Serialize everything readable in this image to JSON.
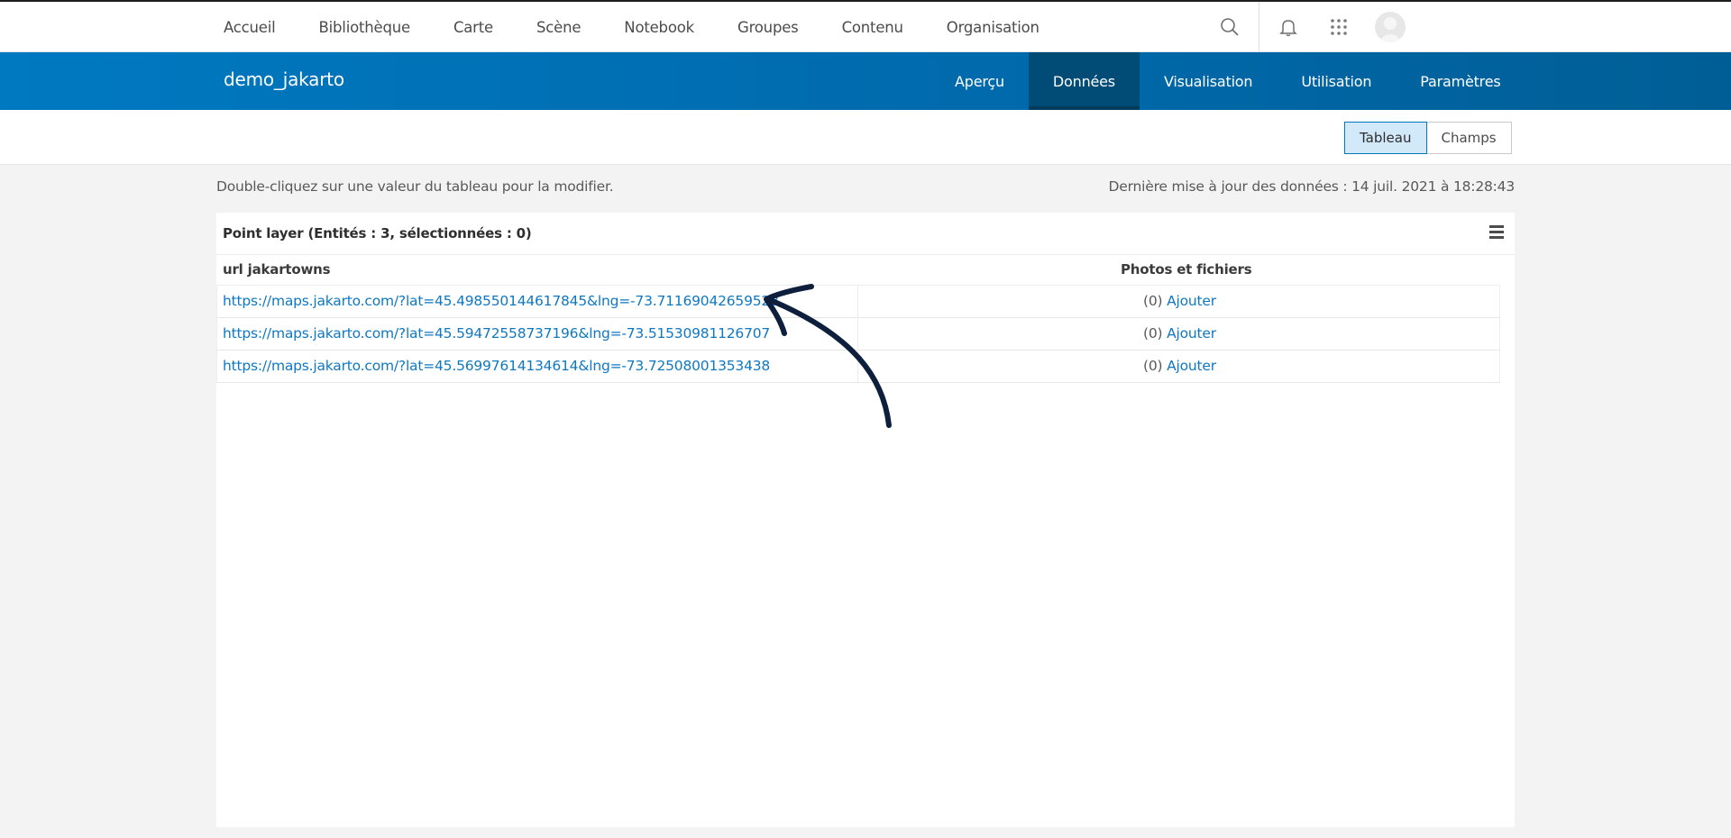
{
  "topnav": {
    "items": [
      "Accueil",
      "Bibliothèque",
      "Carte",
      "Scène",
      "Notebook",
      "Groupes",
      "Contenu",
      "Organisation"
    ]
  },
  "header": {
    "title": "demo_jakarto",
    "tabs": [
      "Aperçu",
      "Données",
      "Visualisation",
      "Utilisation",
      "Paramètres"
    ],
    "active_tab": "Données"
  },
  "view_toggle": {
    "table_label": "Tableau",
    "fields_label": "Champs",
    "active": "Tableau"
  },
  "hint_text": "Double-cliquez sur une valeur du tableau pour la modifier.",
  "last_updated": "Dernière mise à jour des données : 14 juil. 2021 à 18:28:43",
  "layer_table": {
    "title": "Point layer (Entités : 3, sélectionnées : 0)",
    "columns": [
      "url jakartowns",
      "Photos et fichiers"
    ],
    "rows": [
      {
        "url": "https://maps.jakarto.com/?lat=45.498550144617845&lng=-73.71169042659523",
        "count": "(0)",
        "action": "Ajouter"
      },
      {
        "url": "https://maps.jakarto.com/?lat=45.59472558737196&lng=-73.51530981126707",
        "count": "(0)",
        "action": "Ajouter"
      },
      {
        "url": "https://maps.jakarto.com/?lat=45.56997614134614&lng=-73.72508001353438",
        "count": "(0)",
        "action": "Ajouter"
      }
    ]
  },
  "colors": {
    "brand_blue": "#0079c1",
    "active_tab": "#004c76",
    "link": "#0f78c0",
    "annotation_arrow": "#0d1f3c"
  },
  "icons": [
    "search-icon",
    "bell-icon",
    "apps-grid-icon",
    "user-avatar-icon",
    "table-menu-icon"
  ]
}
